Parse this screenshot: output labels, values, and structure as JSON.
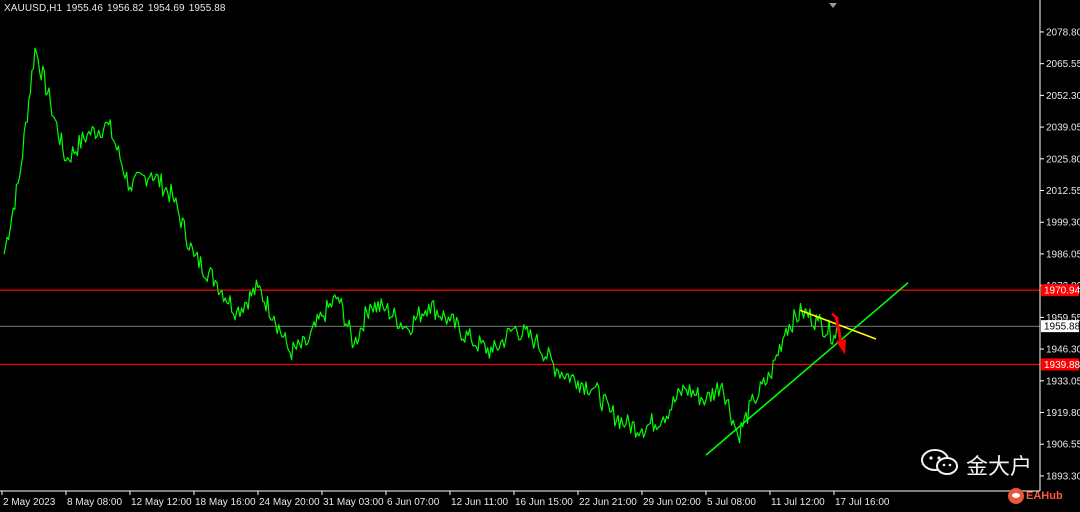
{
  "header": {
    "symbol": "XAUUSD,H1",
    "open": "1955.46",
    "high": "1956.82",
    "low": "1954.69",
    "close": "1955.88"
  },
  "chart_data": {
    "type": "line",
    "title": "",
    "xlabel": "",
    "ylabel": "",
    "ylim": [
      1887.0,
      2086.3
    ],
    "x_ticks": [
      "2 May 2023",
      "8 May 08:00",
      "12 May 12:00",
      "18 May 16:00",
      "24 May 20:00",
      "31 May 03:00",
      "6 Jun 07:00",
      "12 Jun 11:00",
      "16 Jun 15:00",
      "22 Jun 21:00",
      "29 Jun 02:00",
      "5 Jul 08:00",
      "11 Jul 12:00",
      "17 Jul 16:00"
    ],
    "y_ticks": [
      "2078.80",
      "2065.55",
      "2052.30",
      "2039.05",
      "2025.80",
      "2012.55",
      "1999.30",
      "1986.05",
      "1972.80",
      "1959.55",
      "1946.30",
      "1933.05",
      "1919.80",
      "1906.55",
      "1893.30"
    ],
    "series": [
      {
        "color": "#00ff00",
        "x": [
          "2 May 2023",
          "3 May",
          "5 May",
          "5 May",
          "8 May 08:00",
          "10 May",
          "11 May",
          "12 May 12:00",
          "15 May",
          "16 May",
          "18 May 16:00",
          "19 May",
          "22 May",
          "24 May 20:00",
          "25 May",
          "26 May",
          "29 May",
          "31 May 03:00",
          "1 Jun",
          "2 Jun",
          "5 Jun",
          "6 Jun 07:00",
          "7 Jun",
          "9 Jun",
          "12 Jun 11:00",
          "13 Jun",
          "15 Jun",
          "16 Jun 15:00",
          "19 Jun",
          "20 Jun",
          "22 Jun 21:00",
          "23 Jun",
          "26 Jun",
          "27 Jun",
          "29 Jun 02:00",
          "30 Jun",
          "3 Jul",
          "5 Jul 08:00",
          "6 Jul",
          "7 Jul",
          "10 Jul",
          "11 Jul 12:00",
          "12 Jul",
          "13 Jul",
          "14 Jul",
          "17 Jul 16:00",
          "18 Jul"
        ],
        "values": [
          1986,
          2018,
          2072,
          2049,
          2025,
          2036,
          2040,
          2014,
          2020,
          2010,
          1985,
          1975,
          1962,
          1972,
          1960,
          1945,
          1948,
          1960,
          1968,
          1948,
          1965,
          1963,
          1955,
          1965,
          1958,
          1950,
          1945,
          1955,
          1950,
          1938,
          1933,
          1930,
          1920,
          1915,
          1913,
          1918,
          1930,
          1925,
          1932,
          1910,
          1925,
          1935,
          1955,
          1962,
          1958,
          1952,
          1955.88
        ]
      }
    ],
    "horizontal_lines": [
      {
        "price": 1970.94,
        "label": "1970.94",
        "color": "#ff0000"
      },
      {
        "price": 1939.88,
        "label": "1939.88",
        "color": "#ff0000"
      },
      {
        "price": 1955.88,
        "label": "1955.88",
        "color": "#c8c8c8"
      }
    ],
    "trendlines": [
      {
        "name": "",
        "color": "#00ff00",
        "from": [
          "5 Jul 08:00",
          1902
        ],
        "to": [
          "20 Jul",
          1974
        ]
      },
      {
        "name": "",
        "color": "#ffff00",
        "from": [
          "13 Jul",
          1962.5
        ],
        "to": [
          "17 Jul 16:00",
          1950.5
        ]
      }
    ],
    "annotation_arrow": {
      "color": "#ff0000",
      "direction": "down"
    },
    "grid": false,
    "background": "#000000",
    "colors": {
      "axis": "#ffffff",
      "text": "#e8e8e8"
    }
  },
  "watermark": {
    "text": "金大户",
    "icon": "wechat-icon",
    "badge": "EAHub",
    "badge_icon": "eahub-logo-icon",
    "badge_color": "#ff5a3c"
  }
}
